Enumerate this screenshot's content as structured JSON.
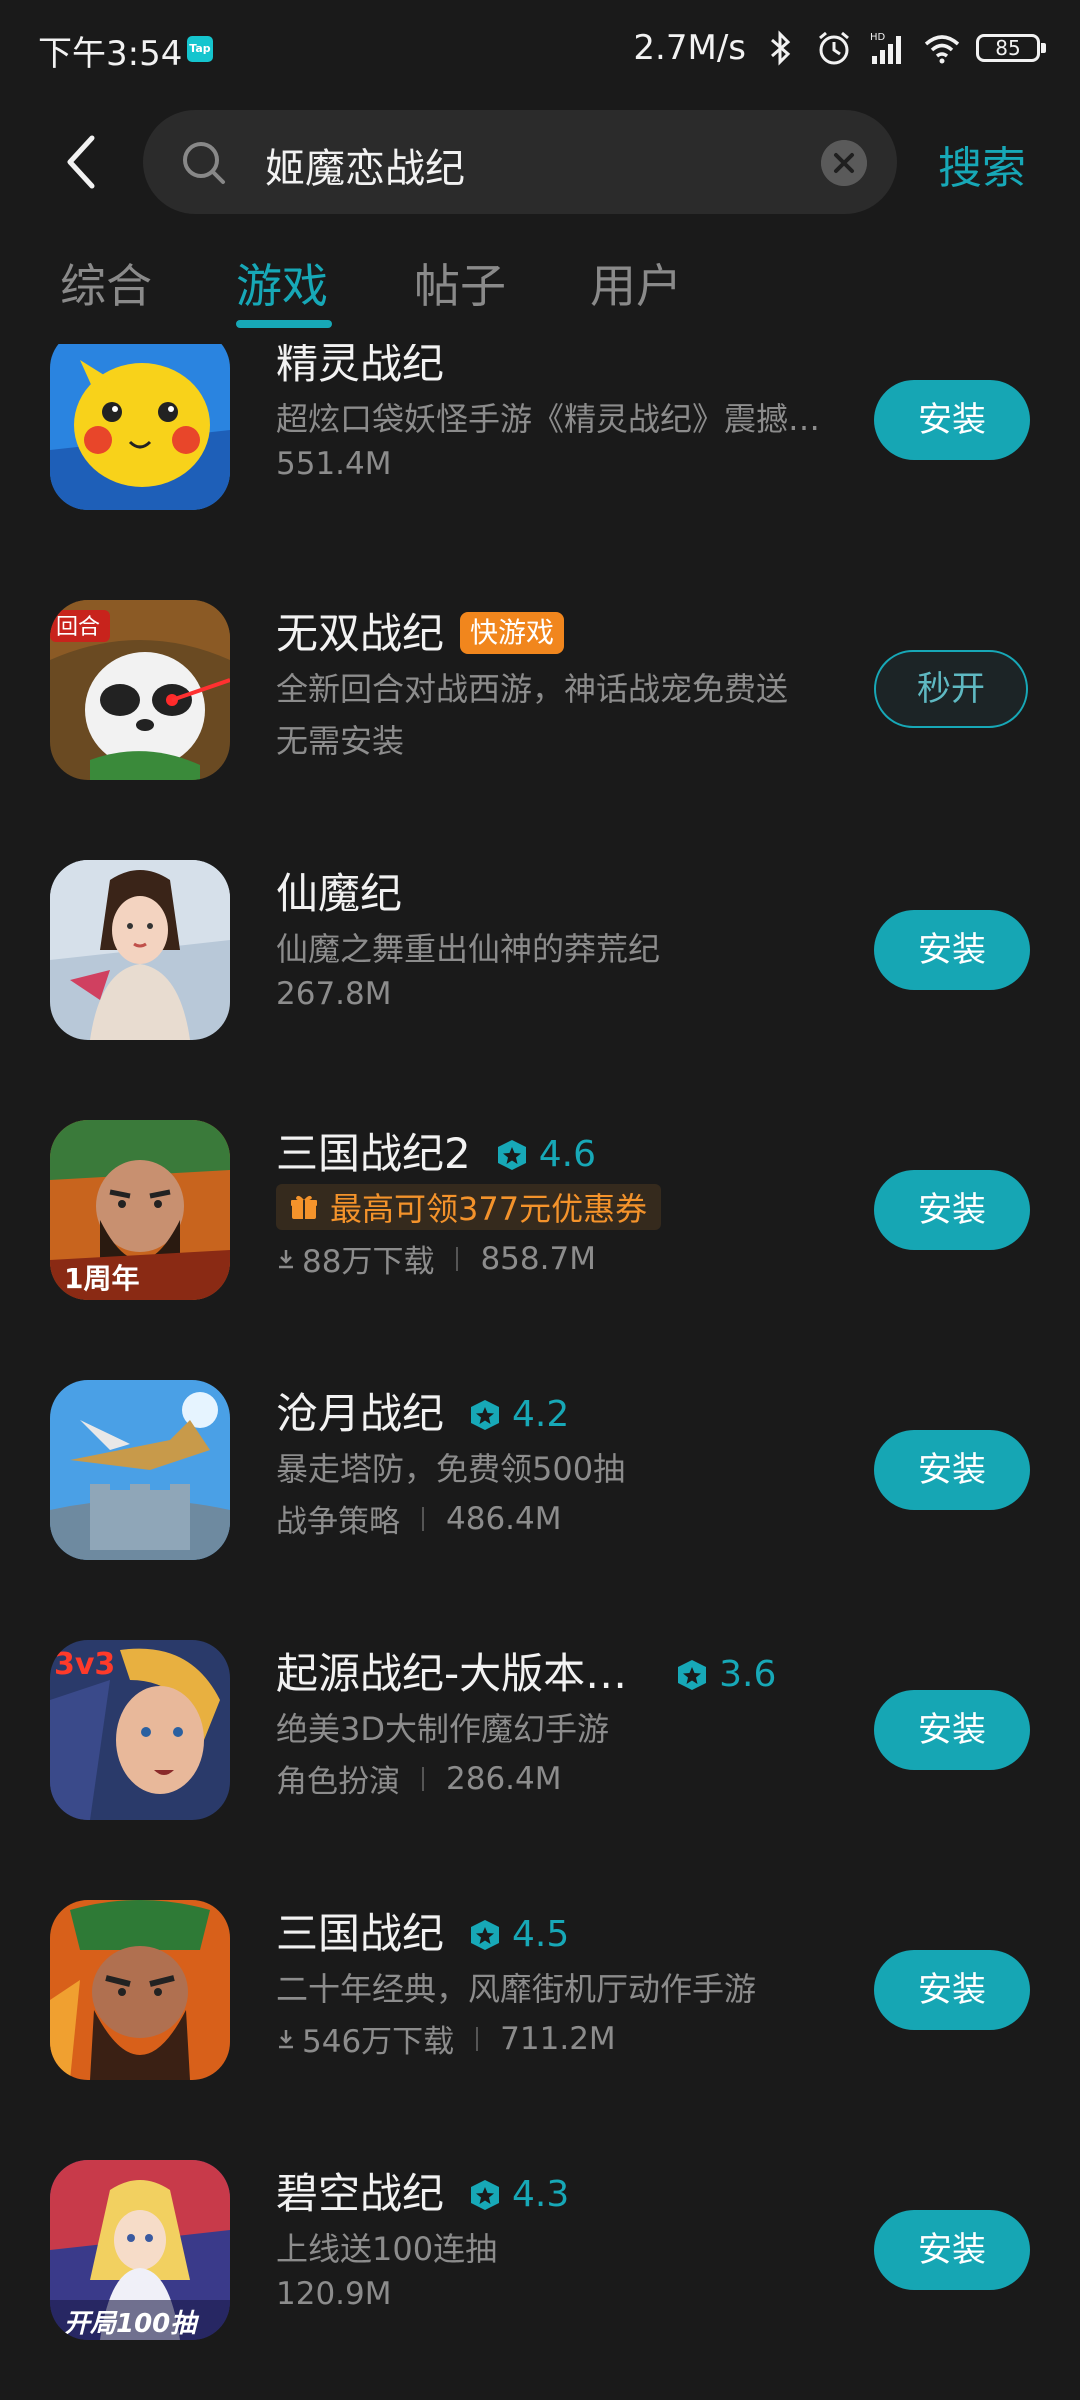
{
  "status_bar": {
    "time": "下午3:54",
    "app_badge": "Tap",
    "net_speed": "2.7M/s",
    "battery": "85"
  },
  "search": {
    "query": "姬魔恋战纪",
    "submit_label": "搜索"
  },
  "tabs": [
    {
      "label": "综合",
      "active": false
    },
    {
      "label": "游戏",
      "active": true
    },
    {
      "label": "帖子",
      "active": false
    },
    {
      "label": "用户",
      "active": false
    }
  ],
  "colors": {
    "accent": "#16a6b4",
    "background": "#1a1a1a",
    "quick_badge": "#f1861d",
    "coupon": "#f4932b"
  },
  "apps": [
    {
      "name": "精灵战纪",
      "desc": "超炫口袋妖怪手游《精灵战纪》震撼…",
      "size": "551.4M",
      "button": "安装"
    },
    {
      "name": "无双战纪",
      "badge": "快游戏",
      "desc": "全新回合对战西游，神话战宠免费送",
      "note": "无需安装",
      "button": "秒开"
    },
    {
      "name": "仙魔纪",
      "desc": "仙魔之舞重出仙神的莽荒纪",
      "size": "267.8M",
      "button": "安装"
    },
    {
      "name": "三国战纪2",
      "rating": "4.6",
      "coupon": "最高可领377元优惠券",
      "downloads": "88万下载",
      "size": "858.7M",
      "button": "安装"
    },
    {
      "name": "沧月战纪",
      "rating": "4.2",
      "desc": "暴走塔防，免费领500抽",
      "category": "战争策略",
      "size": "486.4M",
      "button": "安装"
    },
    {
      "name": "起源战纪-大版本…",
      "rating": "3.6",
      "desc": "绝美3D大制作魔幻手游",
      "category": "角色扮演",
      "size": "286.4M",
      "button": "安装"
    },
    {
      "name": "三国战纪",
      "rating": "4.5",
      "desc": "二十年经典，风靡街机厅动作手游",
      "downloads": "546万下载",
      "size": "711.2M",
      "button": "安装"
    },
    {
      "name": "碧空战纪",
      "rating": "4.3",
      "desc": "上线送100连抽",
      "size": "120.9M",
      "button": "安装"
    }
  ]
}
